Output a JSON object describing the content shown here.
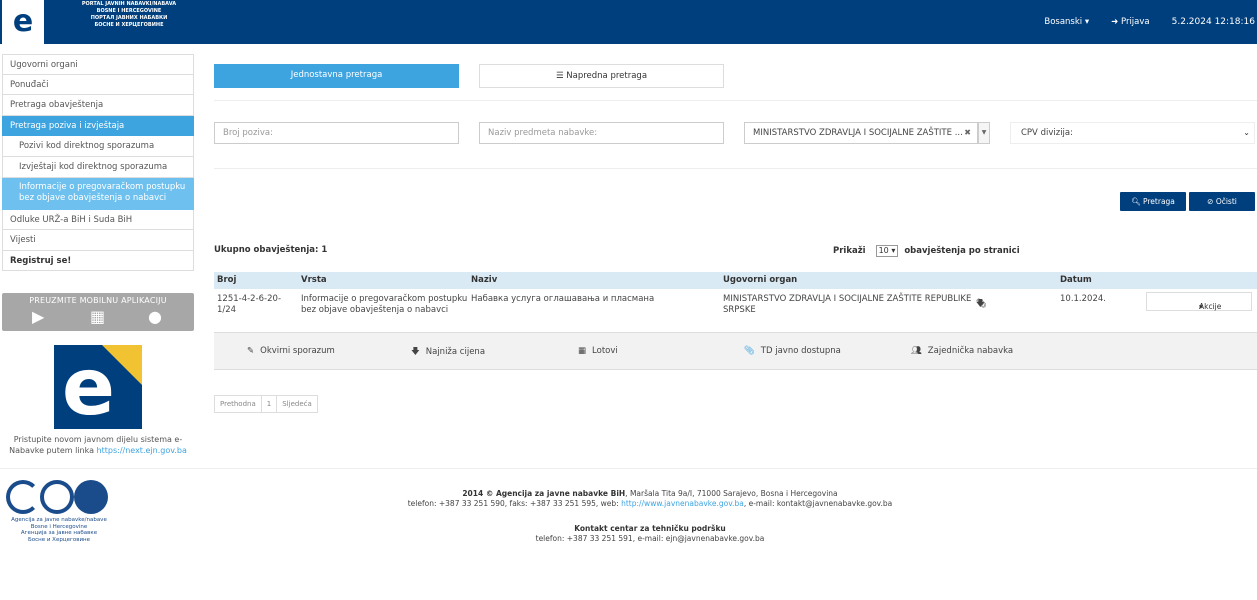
{
  "header": {
    "portal_title_lines": [
      "PORTAL JAVNIH NABAVKI/NABAVA",
      "BOSNE I HERCEGOVINE",
      "ПОРТАЛ ЈАВНИХ НАБАВКИ",
      "БОСНЕ И ХЕРЦЕГОВИНЕ"
    ],
    "language": "Bosanski",
    "login": "Prijava",
    "datetime": "5.2.2024 12:18:16"
  },
  "sidebar": {
    "items": [
      {
        "label": "Ugovorni organi"
      },
      {
        "label": "Ponuđači"
      },
      {
        "label": "Pretraga obavještenja"
      },
      {
        "label": "Pretraga poziva i izvještaja"
      },
      {
        "label": "Pozivi kod direktnog sporazuma"
      },
      {
        "label": "Izvještaji kod direktnog sporazuma"
      },
      {
        "label": "Informacije o pregovaračkom postupku bez objave obavještenja o nabavci"
      },
      {
        "label": "Odluke URŽ-a BiH i Suda BiH"
      },
      {
        "label": "Vijesti"
      },
      {
        "label": "Registruj se!"
      }
    ],
    "mobile_title": "PREUZMITE MOBILNU APLIKACIJU",
    "promo_text": "Pristupite novom javnom dijelu sistema e-Nabavke putem linka",
    "promo_link": "https://next.ejn.gov.ba"
  },
  "search": {
    "tab_simple": "Jednostavna pretraga",
    "tab_advanced": "Napredna pretraga",
    "broj_placeholder": "Broj poziva:",
    "naziv_placeholder": "Naziv predmeta nabavke:",
    "organ_value": "MINISTARSTVO ZDRAVLJA I SOCIJALNE ZAŠTITE ...",
    "cpv_value": "CPV divizija:",
    "search_button": "Pretraga",
    "clear_button": "Očisti"
  },
  "results": {
    "total_label": "Ukupno obavještenja: 1",
    "show_label": "Prikaži",
    "per_page": "10",
    "per_page_suffix": "obavještenja po stranici",
    "columns": [
      "Broj",
      "Vrsta",
      "Naziv",
      "Ugovorni organ",
      "Datum"
    ],
    "rows": [
      {
        "broj": "1251-4-2-6-20-1/24",
        "vrsta": "Informacije o pregovaračkom postupku bez objave obavještenja o nabavci",
        "naziv": "Набавка услуга оглашавања и пласмана",
        "organ": "MINISTARSTVO ZDRAVLJA I SOCIJALNE ZAŠTITE REPUBLIKE SRPSKE",
        "datum": "10.1.2024.",
        "action": "Akcije"
      }
    ]
  },
  "legend": {
    "items": [
      "Okvirni sporazum",
      "Najniža cijena",
      "Lotovi",
      "TD javno dostupna",
      "Zajednička nabavka"
    ]
  },
  "pager": {
    "prev": "Prethodna",
    "page": "1",
    "next": "Sljedeća"
  },
  "footer": {
    "agency_lines": [
      "Agencija za javne nabavke/nabave",
      "Bosne i Hercegovine",
      "Агенција за јавне набавке",
      "Босне и Херцеговине"
    ],
    "line1_bold": "2014 © Agencija za javne nabavke BiH",
    "line1_rest": ", Maršala Tita 9a/I, 71000 Sarajevo, Bosna i Hercegovina",
    "line2_pre": "telefon: +387 33 251 590, faks: +387 33 251 595, web:",
    "line2_link": "http://www.javnenabavke.gov.ba",
    "line2_post": ", e-mail: kontakt@javnenabavke.gov.ba",
    "line3_bold": "Kontakt centar za tehničku podršku",
    "line4": "telefon: +387 33 251 591, e-mail: ejn@javnenabavke.gov.ba"
  },
  "colors": {
    "header_bg": "#003f7d",
    "accent": "#3ea4e0",
    "accent_light": "#6ec1ef",
    "table_head": "#d9eaf5"
  }
}
